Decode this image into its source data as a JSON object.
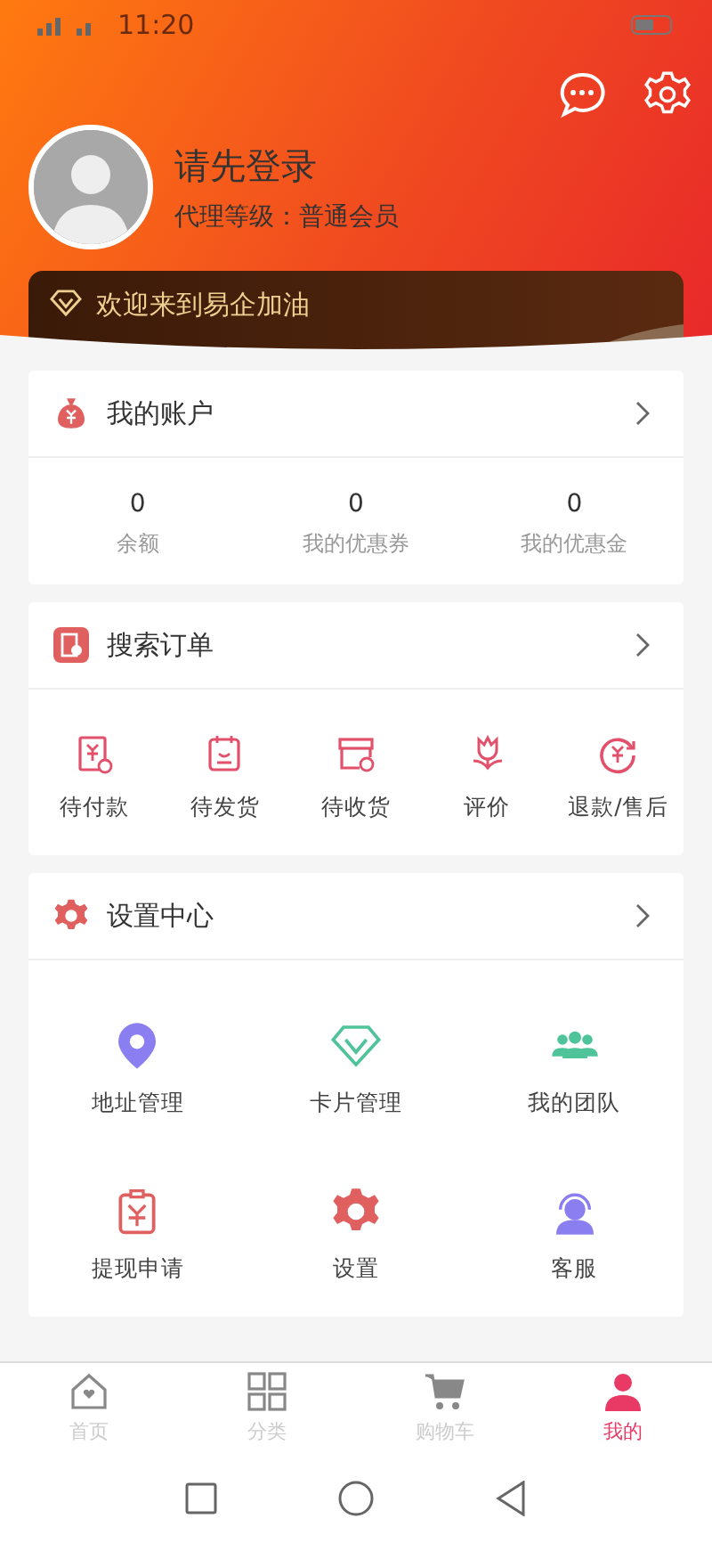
{
  "status_bar": {
    "time": "11:20"
  },
  "profile": {
    "name": "请先登录",
    "level": "代理等级：普通会员"
  },
  "banner": {
    "text": "欢迎来到易企加油"
  },
  "account": {
    "title": "我的账户",
    "stats": [
      {
        "value": "0",
        "label": "余额"
      },
      {
        "value": "0",
        "label": "我的优惠券"
      },
      {
        "value": "0",
        "label": "我的优惠金"
      }
    ]
  },
  "orders": {
    "title": "搜索订单",
    "items": [
      {
        "label": "待付款"
      },
      {
        "label": "待发货"
      },
      {
        "label": "待收货"
      },
      {
        "label": "评价"
      },
      {
        "label": "退款/售后"
      }
    ]
  },
  "settings": {
    "title": "设置中心",
    "items": [
      {
        "label": "地址管理"
      },
      {
        "label": "卡片管理"
      },
      {
        "label": "我的团队"
      },
      {
        "label": "提现申请"
      },
      {
        "label": "设置"
      },
      {
        "label": "客服"
      }
    ]
  },
  "tab_bar": [
    {
      "label": "首页",
      "selected": false
    },
    {
      "label": "分类",
      "selected": false
    },
    {
      "label": "购物车",
      "selected": false
    },
    {
      "label": "我的",
      "selected": true
    }
  ]
}
